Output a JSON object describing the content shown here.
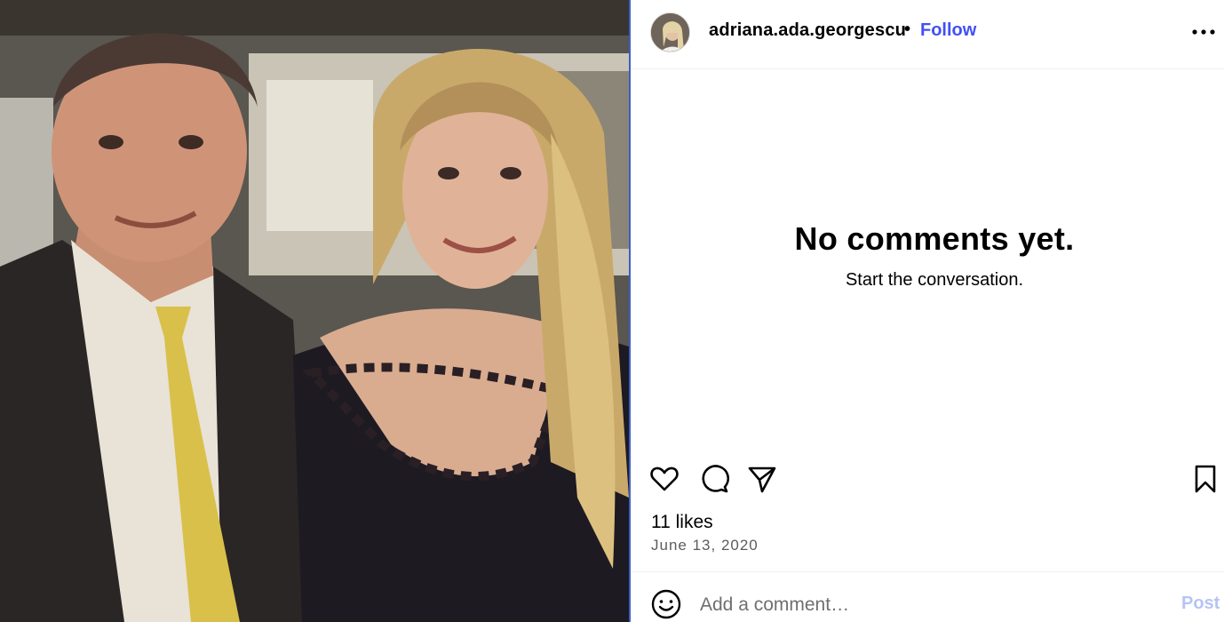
{
  "post": {
    "username": "adriana.ada.georgescu",
    "separator": "•",
    "follow_label": "Follow",
    "more_icon": "more-horizontal-icon",
    "photo_description_icon": "post-photo"
  },
  "comments": {
    "empty_title": "No comments yet.",
    "empty_subtitle": "Start the conversation."
  },
  "actions": {
    "like_icon": "heart-icon",
    "comment_icon": "comment-icon",
    "share_icon": "share-icon",
    "save_icon": "bookmark-icon"
  },
  "stats": {
    "likes": "11 likes",
    "date": "June 13, 2020"
  },
  "composer": {
    "emoji_icon": "emoji-icon",
    "placeholder": "Add a comment…",
    "post_label": "Post"
  },
  "colors": {
    "follow": "#4150f7",
    "post_disabled": "#b6c4f5",
    "divider": "#3d5fc2"
  }
}
